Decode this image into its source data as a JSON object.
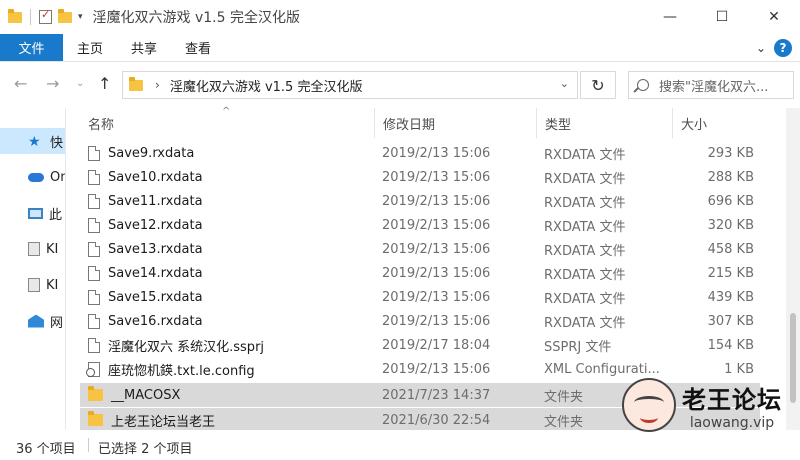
{
  "window": {
    "title": "淫魔化双六游戏 v1.5 完全汉化版",
    "minimize_icon": "—",
    "maximize_icon": "☐",
    "close_icon": "✕"
  },
  "ribbon": {
    "file_tab": "文件",
    "tabs": [
      "主页",
      "共享",
      "查看"
    ]
  },
  "address_bar": {
    "path": "淫魔化双六游戏 v1.5 完全汉化版",
    "search_placeholder": "搜索\"淫魔化双六..."
  },
  "nav_pane": {
    "items": [
      {
        "label": "快",
        "icon": "star-icon",
        "selected": true
      },
      {
        "label": "On",
        "icon": "cloud-icon"
      },
      {
        "label": "此",
        "icon": "computer-icon"
      },
      {
        "label": "KI",
        "icon": "drive-icon"
      },
      {
        "label": "KI",
        "icon": "drive-icon"
      },
      {
        "label": "网",
        "icon": "network-icon"
      }
    ]
  },
  "columns": {
    "name": "名称",
    "date": "修改日期",
    "type": "类型",
    "size": "大小"
  },
  "files": [
    {
      "name": "Save9.rxdata",
      "date": "2019/2/13 15:06",
      "type": "RXDATA 文件",
      "size": "293 KB",
      "icon": "document-icon"
    },
    {
      "name": "Save10.rxdata",
      "date": "2019/2/13 15:06",
      "type": "RXDATA 文件",
      "size": "288 KB",
      "icon": "document-icon"
    },
    {
      "name": "Save11.rxdata",
      "date": "2019/2/13 15:06",
      "type": "RXDATA 文件",
      "size": "696 KB",
      "icon": "document-icon"
    },
    {
      "name": "Save12.rxdata",
      "date": "2019/2/13 15:06",
      "type": "RXDATA 文件",
      "size": "320 KB",
      "icon": "document-icon"
    },
    {
      "name": "Save13.rxdata",
      "date": "2019/2/13 15:06",
      "type": "RXDATA 文件",
      "size": "458 KB",
      "icon": "document-icon"
    },
    {
      "name": "Save14.rxdata",
      "date": "2019/2/13 15:06",
      "type": "RXDATA 文件",
      "size": "215 KB",
      "icon": "document-icon"
    },
    {
      "name": "Save15.rxdata",
      "date": "2019/2/13 15:06",
      "type": "RXDATA 文件",
      "size": "439 KB",
      "icon": "document-icon"
    },
    {
      "name": "Save16.rxdata",
      "date": "2019/2/13 15:06",
      "type": "RXDATA 文件",
      "size": "307 KB",
      "icon": "document-icon"
    },
    {
      "name": "淫魔化双六 系统汉化.ssprj",
      "date": "2019/2/17 18:04",
      "type": "SSPRJ 文件",
      "size": "154 KB",
      "icon": "document-icon"
    },
    {
      "name": "座珫惚机鍈.txt.le.config",
      "date": "2019/2/13 15:06",
      "type": "XML Configurati...",
      "size": "1 KB",
      "icon": "config-file-icon"
    },
    {
      "name": "__MACOSX",
      "date": "2021/7/23 14:37",
      "type": "文件夹",
      "size": "",
      "icon": "folder-icon",
      "selected": true
    },
    {
      "name": "上老王论坛当老王",
      "date": "2021/6/30 22:54",
      "type": "文件夹",
      "size": "",
      "icon": "folder-icon",
      "selected": true
    }
  ],
  "status": {
    "count": "36 个项目",
    "selected": "已选择 2 个项目"
  },
  "watermark": {
    "title": "老王论坛",
    "url": "laowang.vip"
  }
}
